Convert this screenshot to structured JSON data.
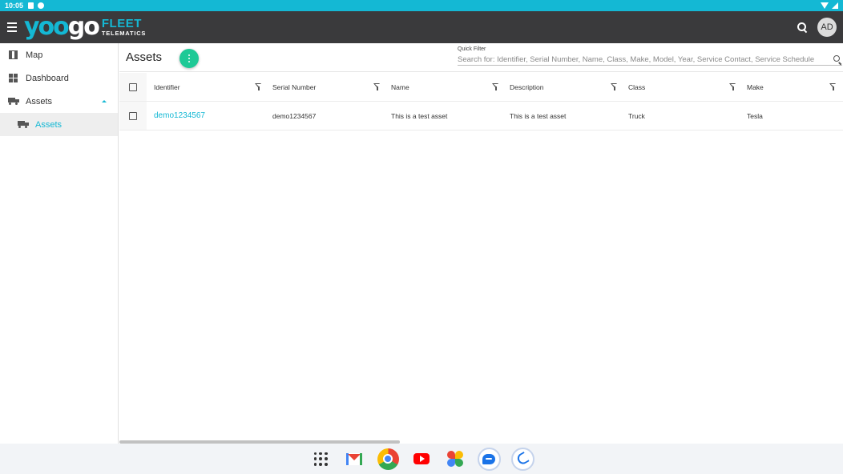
{
  "status_bar": {
    "time": "10:05"
  },
  "app_bar": {
    "logo": {
      "yoo": "yoo",
      "go": "go",
      "fleet": "FLEET",
      "telematics": "TELEMATICS"
    },
    "avatar_initials": "AD"
  },
  "sidebar": {
    "items": [
      {
        "label": "Map",
        "icon": "map-icon"
      },
      {
        "label": "Dashboard",
        "icon": "dashboard-icon"
      },
      {
        "label": "Assets",
        "icon": "truck-icon",
        "expanded": true
      },
      {
        "label": "Assets",
        "icon": "truck-icon",
        "selected": true
      }
    ]
  },
  "main": {
    "title": "Assets",
    "quick_filter": {
      "label": "Quick Filter",
      "placeholder": "Search for: Identifier, Serial Number, Name, Class, Make, Model, Year, Service Contact, Service Schedule"
    },
    "columns": [
      "Identifier",
      "Serial Number",
      "Name",
      "Description",
      "Class",
      "Make"
    ],
    "rows": [
      {
        "identifier": "demo1234567",
        "serial_number": "demo1234567",
        "name": "This is a test asset",
        "description": "This is a test asset",
        "class": "Truck",
        "make": "Tesla"
      }
    ]
  },
  "taskbar": {
    "apps": [
      "apps-grid-icon",
      "gmail-icon",
      "chrome-icon",
      "youtube-icon",
      "photos-icon",
      "messages-icon",
      "phone-icon"
    ]
  },
  "colors": {
    "accent": "#14b8d4",
    "appbar": "#3a3a3c",
    "fab": "#1ec996"
  }
}
